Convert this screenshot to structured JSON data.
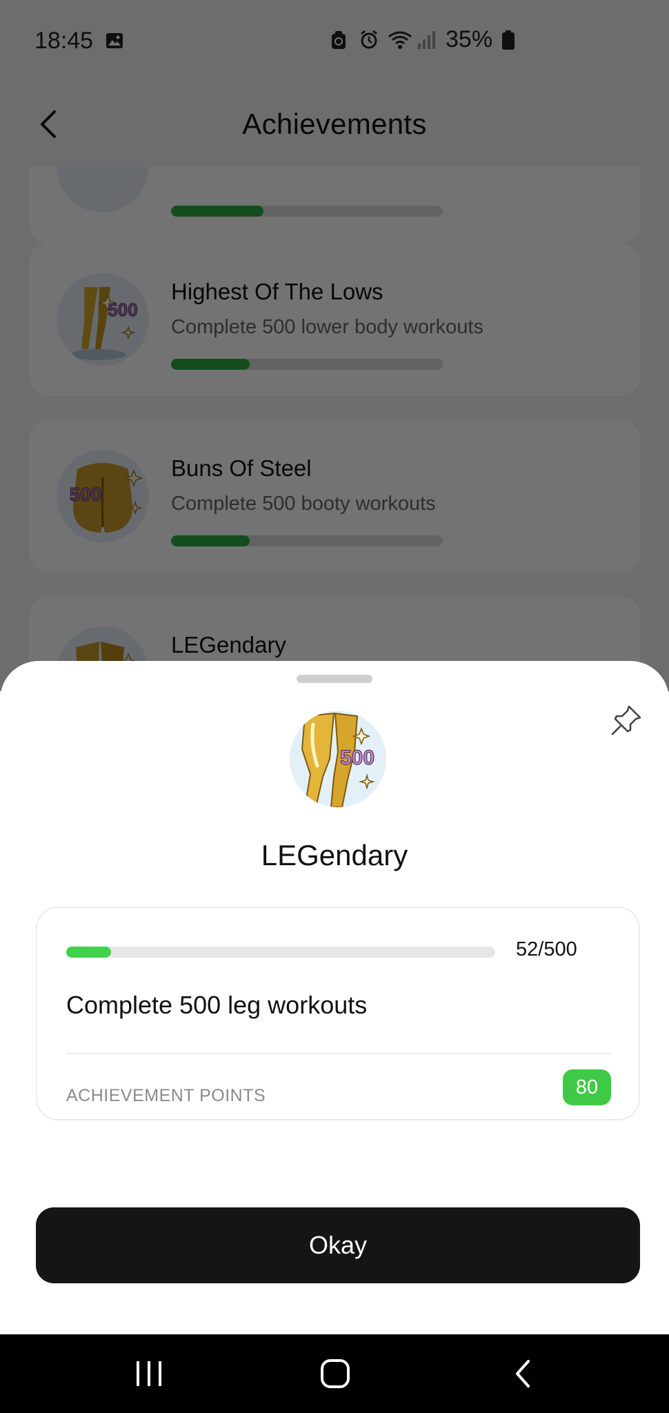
{
  "status_bar": {
    "time": "18:45",
    "battery": "35%",
    "icons": [
      "image-icon",
      "clean-icon",
      "alarm-icon",
      "wifi-icon",
      "signal-icon",
      "battery-icon"
    ]
  },
  "header": {
    "title": "Achievements",
    "back_icon": "chevron-left-icon"
  },
  "achievements": [
    {
      "title": "",
      "description": "",
      "progress": 0.34
    },
    {
      "title": "Highest Of The Lows",
      "description": "Complete 500 lower body workouts",
      "progress": 0.29,
      "badge_number": "500"
    },
    {
      "title": "Buns Of Steel",
      "description": "Complete 500 booty workouts",
      "progress": 0.29,
      "badge_number": "500"
    },
    {
      "title": "LEGendary",
      "description": "",
      "progress": 0.1
    }
  ],
  "sheet": {
    "badge_number": "500",
    "title": "LEGendary",
    "progress": {
      "current": 52,
      "total": 500,
      "label": "52/500"
    },
    "description": "Complete 500 leg workouts",
    "points_label": "ACHIEVEMENT POINTS",
    "points_value": "80",
    "okay_label": "Okay",
    "pin_icon": "pin-icon"
  },
  "nav_bar": {
    "icons": [
      "recents-icon",
      "home-icon",
      "back-icon"
    ]
  },
  "colors": {
    "progress_green": "#2ea843",
    "sheet_progress_green": "#42d14a",
    "points_badge_green": "#3fc946",
    "button_dark": "#151515"
  }
}
